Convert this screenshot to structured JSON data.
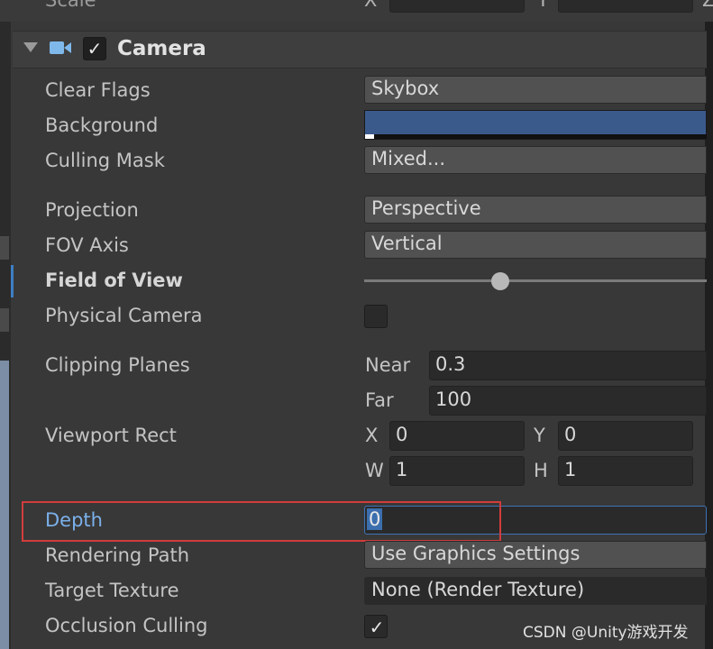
{
  "top_row": {
    "label": "Scale",
    "x_letter": "X",
    "y_letter": "Y",
    "z_letter": "Z"
  },
  "component": {
    "title": "Camera",
    "enabled_check": "✓",
    "icon": "camera-icon",
    "foldout_icon": "foldout-triangle-icon"
  },
  "properties": {
    "clear_flags": {
      "label": "Clear Flags",
      "value": "Skybox"
    },
    "background": {
      "label": "Background",
      "color": "#3b5a8c"
    },
    "culling_mask": {
      "label": "Culling Mask",
      "value": "Mixed..."
    },
    "projection": {
      "label": "Projection",
      "value": "Perspective"
    },
    "fov_axis": {
      "label": "FOV Axis",
      "value": "Vertical"
    },
    "field_of_view": {
      "label": "Field of View"
    },
    "physical_camera": {
      "label": "Physical Camera"
    },
    "clipping_planes": {
      "label": "Clipping Planes",
      "near_label": "Near",
      "near_value": "0.3",
      "far_label": "Far",
      "far_value": "100"
    },
    "viewport_rect": {
      "label": "Viewport Rect",
      "x_label": "X",
      "x_value": "0",
      "y_label": "Y",
      "y_value": "0",
      "w_label": "W",
      "w_value": "1",
      "h_label": "H",
      "h_value": "1"
    },
    "depth": {
      "label": "Depth",
      "value": "0"
    },
    "rendering_path": {
      "label": "Rendering Path",
      "value": "Use Graphics Settings"
    },
    "target_texture": {
      "label": "Target Texture",
      "value": "None (Render Texture)"
    },
    "occlusion_culling": {
      "label": "Occlusion Culling",
      "check": "✓"
    }
  },
  "colors": {
    "highlight": "#d23c3c",
    "accent": "#3b6fae"
  },
  "watermark": "CSDN @Unity游戏开发"
}
